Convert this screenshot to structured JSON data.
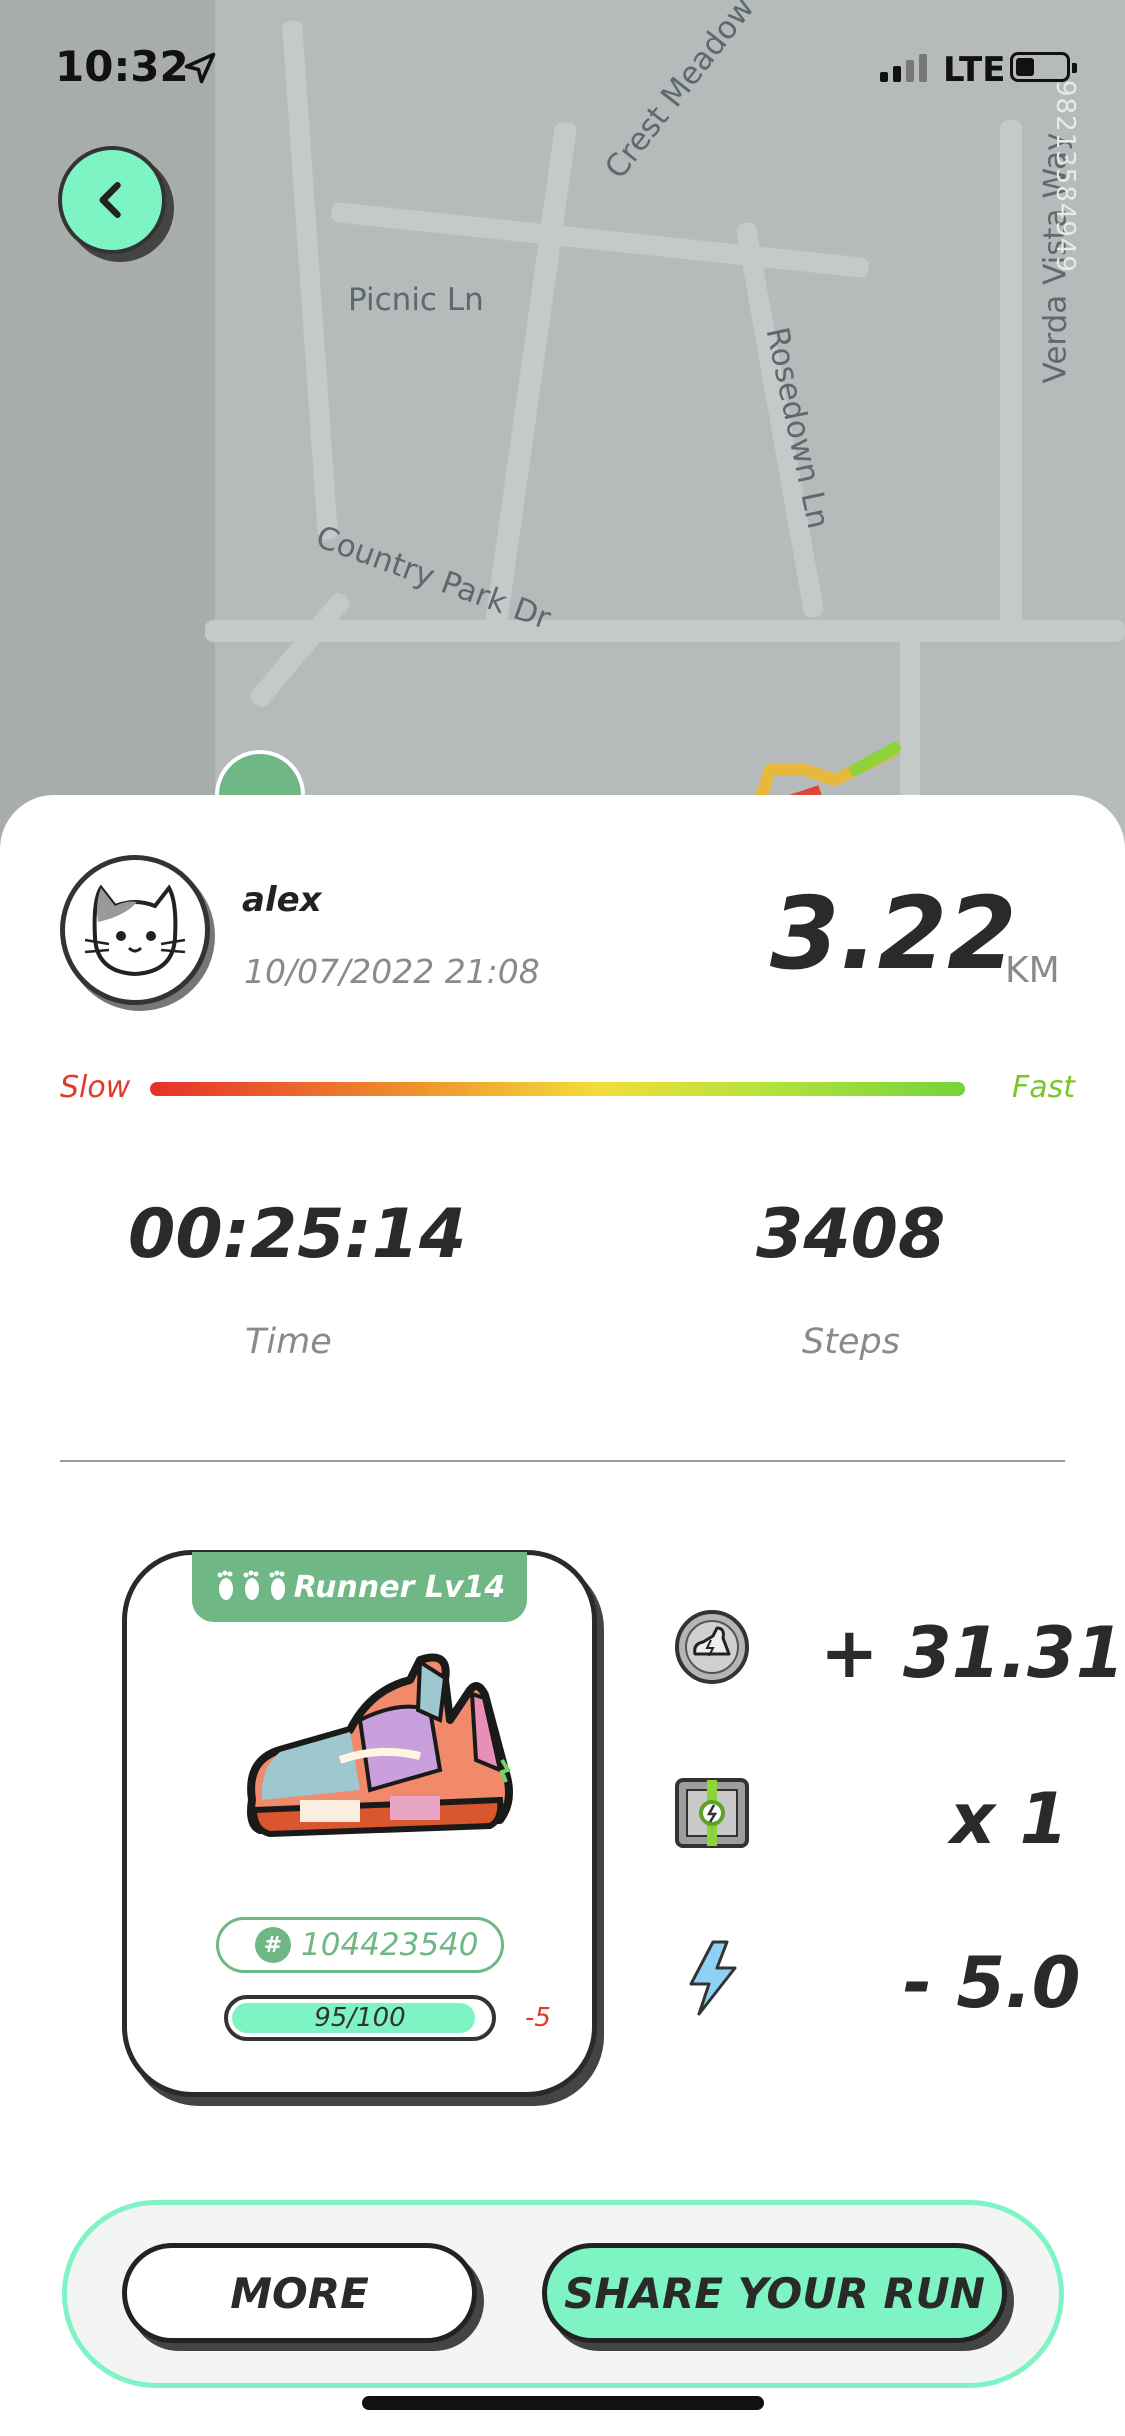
{
  "status_bar": {
    "time": "10:32",
    "network": "LTE"
  },
  "map": {
    "streets": [
      "Crest Meadow",
      "Picnic Ln",
      "Rosedown Ln",
      "Country Park Dr",
      "Verda Vista Way"
    ],
    "vertical_id": "9821358494​9"
  },
  "run": {
    "user": {
      "name": "alex",
      "datetime": "10/07/2022 21:08"
    },
    "distance": {
      "value": "3.22",
      "unit": "KM"
    },
    "speed_scale": {
      "slow_label": "Slow",
      "fast_label": "Fast"
    },
    "time": {
      "value": "00:25:14",
      "label": "Time"
    },
    "steps": {
      "value": "3408",
      "label": "Steps"
    }
  },
  "sneaker_card": {
    "tab_label": "Runner Lv14",
    "id": "104423540",
    "durability": {
      "text": "95/100",
      "fraction": 0.95,
      "delta": "-5"
    }
  },
  "rewards": {
    "gst": "+ 31.31",
    "mystery_box": "x 1",
    "energy": "- 5.0"
  },
  "actions": {
    "more": "MORE",
    "share": "SHARE YOUR RUN"
  },
  "colors": {
    "accent": "#7ef4c4",
    "green": "#6fb784",
    "slow": "#e23a2a",
    "fast": "#79c52b"
  }
}
